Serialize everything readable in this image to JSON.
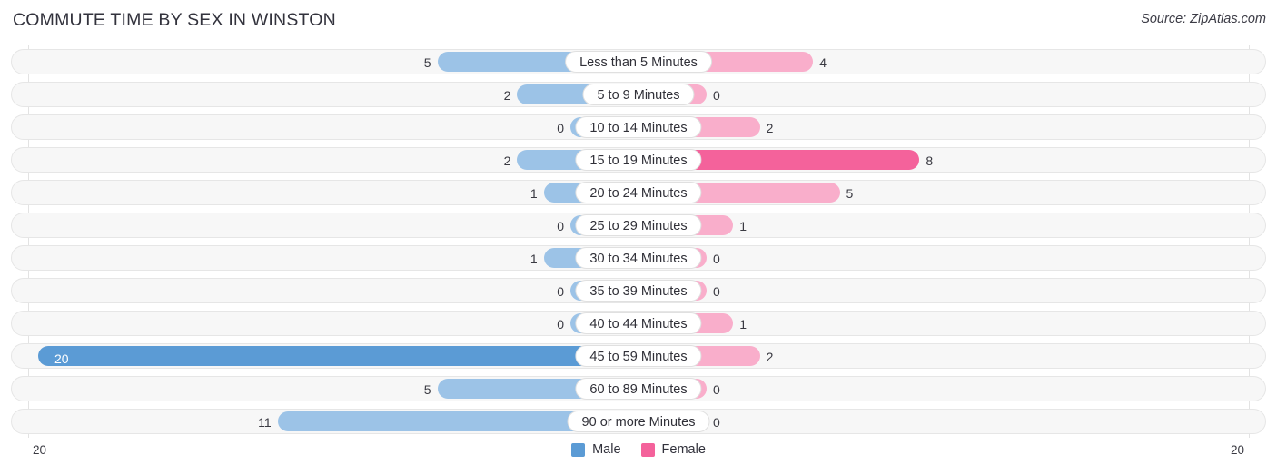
{
  "header": {
    "title": "COMMUTE TIME BY SEX IN WINSTON",
    "source": "Source: ZipAtlas.com"
  },
  "legend": {
    "male_label": "Male",
    "female_label": "Female",
    "male_color": "#5B9BD5",
    "female_color": "#F4629B"
  },
  "axis": {
    "left_label": "20",
    "right_label": "20"
  },
  "colors": {
    "male_light": "#9CC3E7",
    "male_max": "#5B9BD5",
    "female_light": "#F9AECB",
    "female_max": "#F4629B",
    "row_track": "#f7f7f7",
    "gridline": "#e3e3e3"
  },
  "chart_data": {
    "type": "bar",
    "title": "COMMUTE TIME BY SEX IN WINSTON",
    "subtitle": "Source: ZipAtlas.com",
    "orientation": "horizontal-diverging",
    "xlabel": "",
    "ylabel": "",
    "xlim": [
      20,
      20
    ],
    "grid": true,
    "legend_position": "bottom-center",
    "categories": [
      "Less than 5 Minutes",
      "5 to 9 Minutes",
      "10 to 14 Minutes",
      "15 to 19 Minutes",
      "20 to 24 Minutes",
      "25 to 29 Minutes",
      "30 to 34 Minutes",
      "35 to 39 Minutes",
      "40 to 44 Minutes",
      "45 to 59 Minutes",
      "60 to 89 Minutes",
      "90 or more Minutes"
    ],
    "series": [
      {
        "name": "Male",
        "direction": "left",
        "color": "#9CC3E7",
        "max_color": "#5B9BD5",
        "values": [
          5,
          2,
          0,
          2,
          1,
          0,
          1,
          0,
          0,
          20,
          5,
          11
        ],
        "labels": [
          "5",
          "2",
          "0",
          "2",
          "1",
          "0",
          "1",
          "0",
          "0",
          "20",
          "5",
          "11"
        ]
      },
      {
        "name": "Female",
        "direction": "right",
        "color": "#F9AECB",
        "max_color": "#F4629B",
        "values": [
          4,
          0,
          2,
          8,
          5,
          1,
          0,
          0,
          1,
          2,
          0,
          0
        ],
        "labels": [
          "4",
          "0",
          "2",
          "8",
          "5",
          "1",
          "0",
          "0",
          "1",
          "2",
          "0",
          "0"
        ]
      }
    ]
  }
}
